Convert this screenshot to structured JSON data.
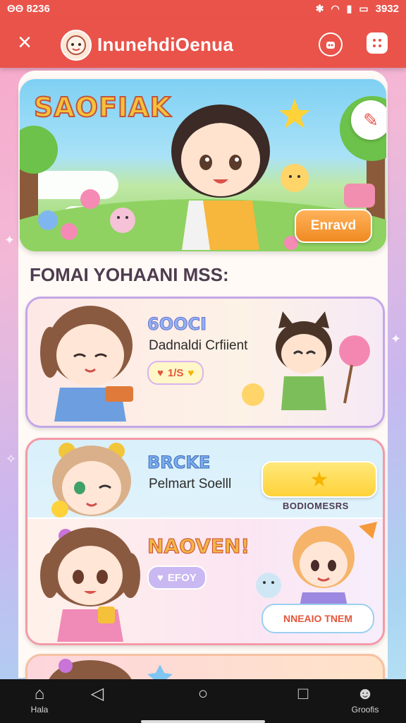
{
  "statusbar": {
    "time": "ΘΘ 8236",
    "right_text": "3932"
  },
  "appbar": {
    "title": "InunehdiOenua",
    "close_glyph": "×"
  },
  "hero": {
    "title": "SAOFIAK",
    "button_label": "Enravd"
  },
  "section": {
    "title": "FOMAI YOHAANI MSS:"
  },
  "cards": [
    {
      "name": "6OOCI",
      "subtitle": "Dadnaldi Crfiient",
      "pill_text": "1/S"
    },
    {
      "name": "BRCKE",
      "subtitle": "Pelmart Soelll",
      "caption": "BODIOMESRS"
    },
    {
      "name": "NAOVEN!",
      "pill_text": "EFOY",
      "button_label": "NNEAIO TNEM"
    }
  ],
  "bottom_nav": [
    {
      "label": "Hala",
      "icon": "home-icon"
    },
    {
      "label": "",
      "icon": "back-icon"
    },
    {
      "label": "",
      "icon": "circle-icon"
    },
    {
      "label": "",
      "icon": "square-icon"
    },
    {
      "label": "Groofis",
      "icon": "profile-icon"
    }
  ],
  "colors": {
    "appbar": "#e9534a",
    "accent_orange": "#f08a22",
    "accent_yellow": "#ffd23a"
  }
}
